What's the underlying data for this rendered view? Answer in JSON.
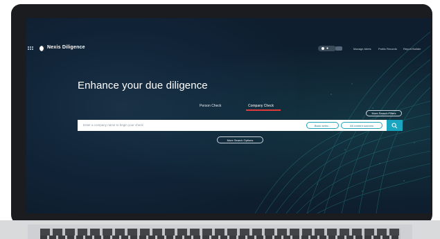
{
  "header": {
    "brand": "Nexis Diligence",
    "nav": [
      "Manage Alerts",
      "Public Records",
      "Report Builder"
    ]
  },
  "hero": {
    "title": "Enhance your due diligence"
  },
  "tabs": [
    {
      "label": "Person Check",
      "active": false
    },
    {
      "label": "Company Check",
      "active": true
    }
  ],
  "search": {
    "placeholder": "Enter a company name to begin your check",
    "filter_pills": [
      "Basic selec...",
      "All content sources"
    ],
    "more_search_filters": "More Search Filters",
    "more_search_options": "More Search Options"
  },
  "icons": {
    "menu": "grid-menu-icon",
    "logo": "logo-icon",
    "theme": "theme-toggle-icon",
    "search": "search-icon",
    "chevron": "chevron-down-icon"
  },
  "colors": {
    "background": "#0e1e2e",
    "accent": "#1aa6c0",
    "tab_underline": "#e03a3a"
  }
}
